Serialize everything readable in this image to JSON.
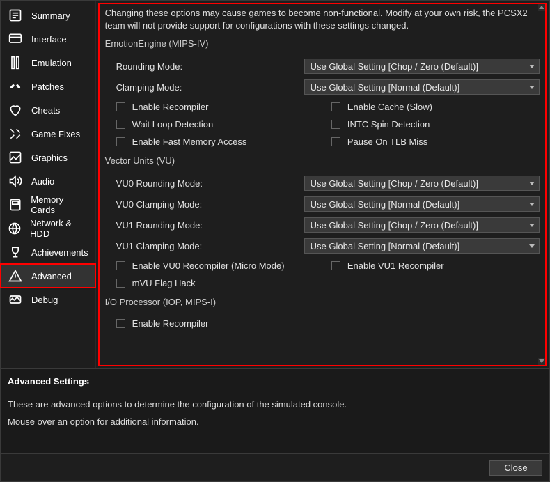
{
  "sidebar": {
    "items": [
      {
        "label": "Summary"
      },
      {
        "label": "Interface"
      },
      {
        "label": "Emulation"
      },
      {
        "label": "Patches"
      },
      {
        "label": "Cheats"
      },
      {
        "label": "Game Fixes"
      },
      {
        "label": "Graphics"
      },
      {
        "label": "Audio"
      },
      {
        "label": "Memory Cards"
      },
      {
        "label": "Network & HDD"
      },
      {
        "label": "Achievements"
      },
      {
        "label": "Advanced"
      },
      {
        "label": "Debug"
      }
    ],
    "selected_index": 11
  },
  "warning": "Changing these options may cause games to become non-functional. Modify at your own risk, the PCSX2 team will not provide support for configurations with these settings changed.",
  "sections": {
    "ee": {
      "title": "EmotionEngine (MIPS-IV)",
      "rounding_label": "Rounding Mode:",
      "rounding_value": "Use Global Setting [Chop / Zero (Default)]",
      "clamping_label": "Clamping Mode:",
      "clamping_value": "Use Global Setting [Normal (Default)]",
      "checks": [
        {
          "label": "Enable Recompiler"
        },
        {
          "label": "Enable Cache (Slow)"
        },
        {
          "label": "Wait Loop Detection"
        },
        {
          "label": "INTC Spin Detection"
        },
        {
          "label": "Enable Fast Memory Access"
        },
        {
          "label": "Pause On TLB Miss"
        }
      ]
    },
    "vu": {
      "title": "Vector Units (VU)",
      "vu0_rounding_label": "VU0 Rounding Mode:",
      "vu0_rounding_value": "Use Global Setting [Chop / Zero (Default)]",
      "vu0_clamping_label": "VU0 Clamping Mode:",
      "vu0_clamping_value": "Use Global Setting [Normal (Default)]",
      "vu1_rounding_label": "VU1 Rounding Mode:",
      "vu1_rounding_value": "Use Global Setting [Chop / Zero (Default)]",
      "vu1_clamping_label": "VU1 Clamping Mode:",
      "vu1_clamping_value": "Use Global Setting [Normal (Default)]",
      "checks": [
        {
          "label": "Enable VU0 Recompiler (Micro Mode)"
        },
        {
          "label": "Enable VU1 Recompiler"
        },
        {
          "label": "mVU Flag Hack"
        }
      ]
    },
    "iop": {
      "title": "I/O Processor (IOP, MIPS-I)",
      "checks": [
        {
          "label": "Enable Recompiler"
        }
      ]
    }
  },
  "info": {
    "title": "Advanced Settings",
    "line1": "These are advanced options to determine the configuration of the simulated console.",
    "line2": "Mouse over an option for additional information."
  },
  "footer": {
    "close_label": "Close"
  }
}
